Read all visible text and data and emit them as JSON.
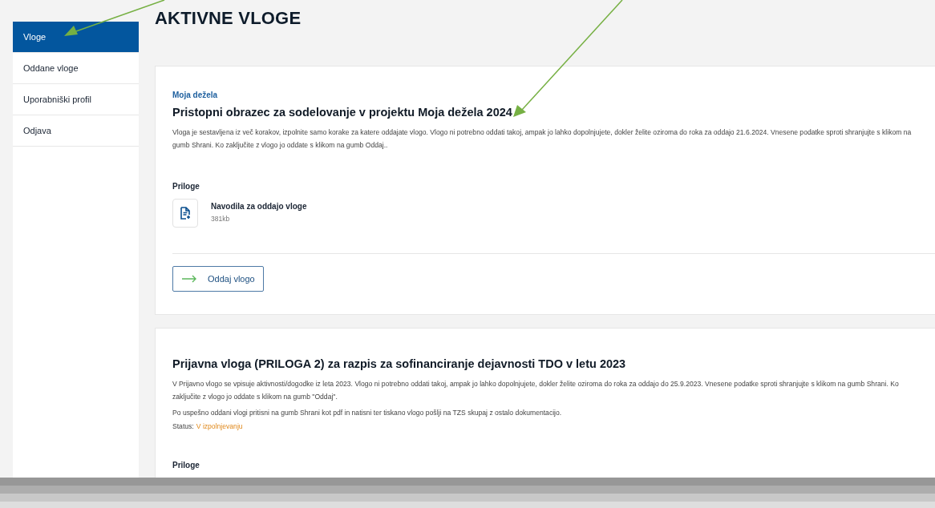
{
  "sidebar": {
    "items": [
      {
        "label": "Vloge",
        "selected": true
      },
      {
        "label": "Oddane vloge",
        "selected": false
      },
      {
        "label": "Uporabniški profil",
        "selected": false
      },
      {
        "label": "Odjava",
        "selected": false
      }
    ]
  },
  "page_title": "AKTIVNE VLOGE",
  "applications": [
    {
      "category": "Moja dežela",
      "title": "Pristopni obrazec za sodelovanje v projektu Moja dežela 2024",
      "paragraphs": [
        "Vloga je sestavljena iz več korakov, izpolnite samo korake za katere oddajate vlogo. Vlogo ni potrebno oddati takoj, ampak jo lahko dopolnjujete, dokler želite oziroma do roka za oddajo 21.6.2024. Vnesene podatke sproti shranjujte s klikom na gumb Shrani. Ko zaključite z vlogo jo oddate s klikom na gumb Oddaj.."
      ],
      "attachments_heading": "Priloge",
      "attachments": [
        {
          "name": "Navodila za oddajo vloge",
          "size": "381kb"
        }
      ],
      "submit_button": "Oddaj vlogo"
    },
    {
      "title": "Prijavna vloga (PRILOGA 2) za razpis za sofinanciranje dejavnosti TDO v letu 2023",
      "paragraphs": [
        "V Prijavno vlogo se vpisuje aktivnosti/dogodke iz leta 2023. Vlogo ni potrebno oddati takoj, ampak jo lahko dopolnjujete, dokler želite oziroma do roka za oddajo do 25.9.2023. Vnesene podatke sproti shranjujte s klikom na gumb Shrani. Ko zaključite z vlogo jo oddate s klikom na gumb \"Oddaj\".",
        "Po uspešno oddani vlogi pritisni na gumb Shrani kot pdf in natisni ter tiskano vlogo pošlji na TZS skupaj z ostalo dokumentacijo."
      ],
      "status_label": "Status:",
      "status_value": "V izpolnjevanju",
      "attachments_heading": "Priloge"
    }
  ]
}
